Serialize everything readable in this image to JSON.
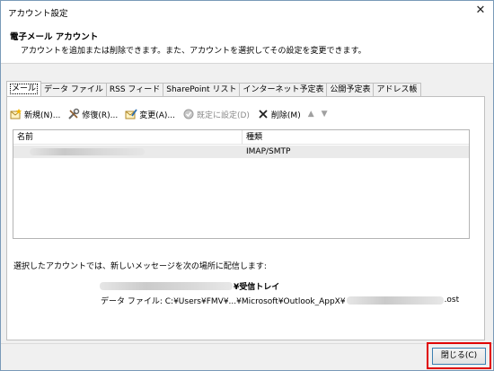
{
  "window": {
    "title": "アカウント設定",
    "close_glyph": "✕"
  },
  "header": {
    "title": "電子メール アカウント",
    "description": "アカウントを追加または削除できます。また、アカウントを選択してその設定を変更できます。"
  },
  "tabs": [
    {
      "label": "メール",
      "active": true
    },
    {
      "label": "データ ファイル"
    },
    {
      "label": "RSS フィード"
    },
    {
      "label": "SharePoint リスト"
    },
    {
      "label": "インターネット予定表"
    },
    {
      "label": "公開予定表"
    },
    {
      "label": "アドレス帳"
    }
  ],
  "toolbar": {
    "new_label": "新規(N)...",
    "repair_label": "修復(R)...",
    "change_label": "変更(A)...",
    "default_label": "既定に設定(D)",
    "delete_label": "削除(M)",
    "up_glyph": "▲",
    "down_glyph": "▼"
  },
  "account_list": {
    "columns": {
      "name": "名前",
      "type": "種類"
    },
    "rows": [
      {
        "type": "IMAP/SMTP"
      }
    ]
  },
  "delivery": {
    "label": "選択したアカウントでは、新しいメッセージを次の場所に配信します:",
    "folder_suffix": "¥受信トレイ",
    "datafile_prefix": "データ ファイル: C:¥Users¥FMV¥...¥Microsoft¥Outlook_AppX¥",
    "datafile_suffix": ".ost"
  },
  "footer": {
    "close_label": "閉じる(C)"
  },
  "colors": {
    "highlight_frame": "#e00000",
    "button_border": "#3c7fb1"
  }
}
